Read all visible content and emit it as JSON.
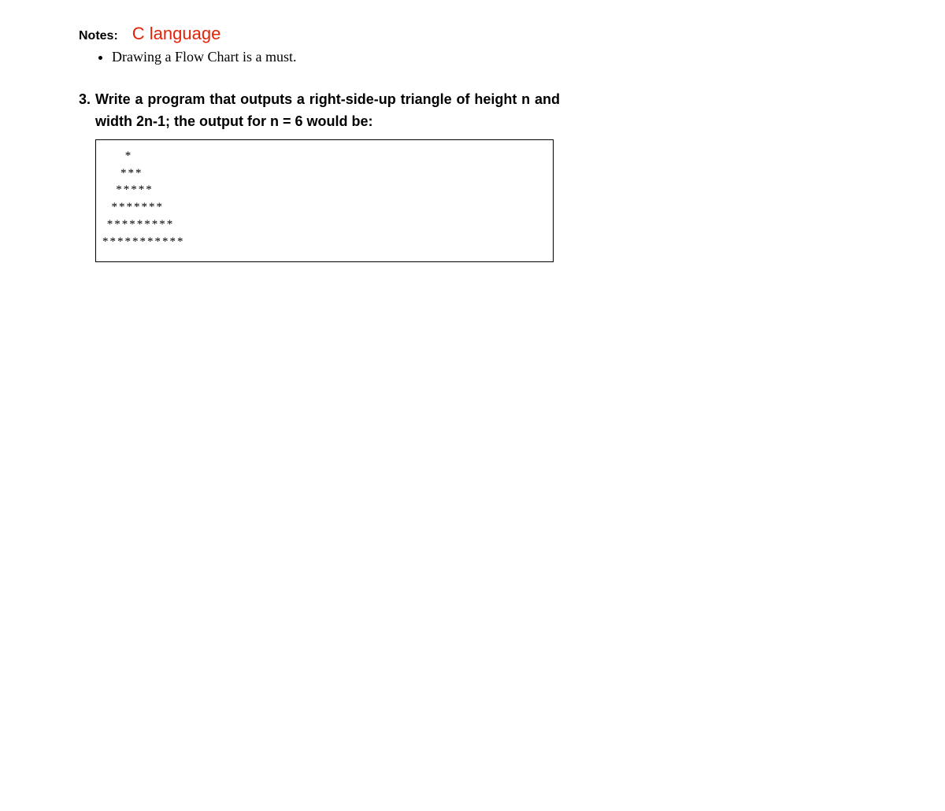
{
  "notes": {
    "label": "Notes:",
    "language": "C language",
    "bullets": [
      "Drawing a Flow Chart is a must."
    ]
  },
  "question": {
    "number": "3.",
    "text": "Write a program that outputs a right-side-up triangle of height n and width 2n-1; the output for n = 6 would be:",
    "output": [
      "     *",
      "    ***",
      "   *****",
      "  *******",
      " *********",
      "***********"
    ]
  }
}
